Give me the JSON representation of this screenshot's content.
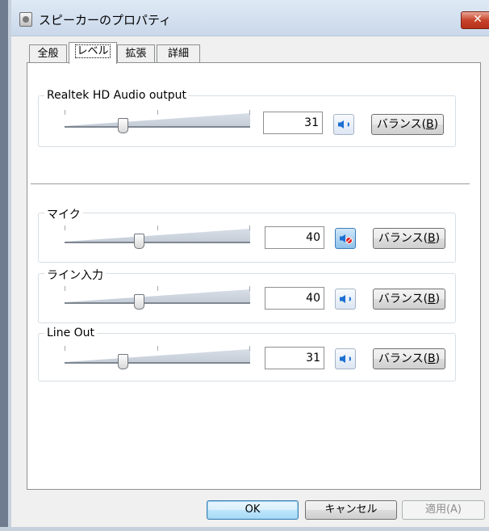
{
  "window": {
    "title": "スピーカーのプロパティ",
    "close_label": "✕"
  },
  "tabs": [
    {
      "label": "全般",
      "active": false
    },
    {
      "label": "レベル",
      "active": true
    },
    {
      "label": "拡張",
      "active": false
    },
    {
      "label": "詳細",
      "active": false
    }
  ],
  "levels": [
    {
      "name": "Realtek HD Audio output",
      "value": "31",
      "muted": false,
      "balance_label": "バランス(",
      "balance_key": "B",
      "balance_end": ")"
    },
    {
      "name": "マイク",
      "value": "40",
      "muted": true,
      "balance_label": "バランス(",
      "balance_key": "B",
      "balance_end": ")"
    },
    {
      "name": "ライン入力",
      "value": "40",
      "muted": false,
      "balance_label": "バランス(",
      "balance_key": "B",
      "balance_end": ")"
    },
    {
      "name": "Line Out",
      "value": "31",
      "muted": false,
      "balance_label": "バランス(",
      "balance_key": "B",
      "balance_end": ")"
    }
  ],
  "buttons": {
    "ok": "OK",
    "cancel": "キャンセル",
    "apply": "適用(A)"
  },
  "icons": {
    "app": "speaker-properties-icon",
    "speaker": "speaker-icon",
    "muted": "speaker-muted-icon"
  },
  "colors": {
    "close_button": "#c7442b",
    "speaker_blue": "#1d6fd2",
    "mute_red": "#e02020"
  }
}
